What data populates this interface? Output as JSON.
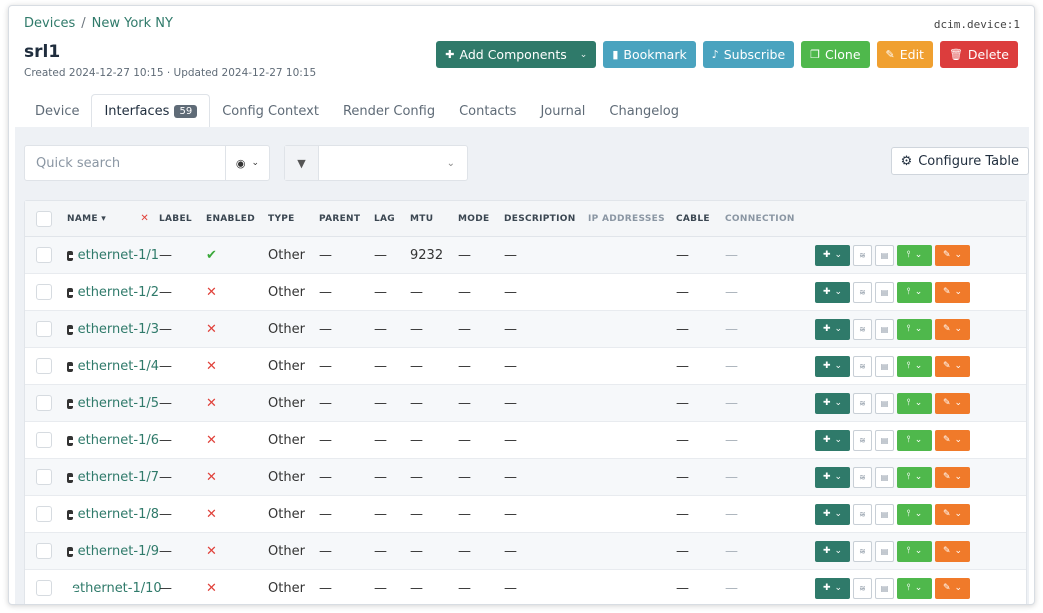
{
  "breadcrumb": [
    "Devices",
    "New York NY"
  ],
  "object_id": "dcim.device:1",
  "title": "srl1",
  "meta": "Created 2024-12-27 10:15 · Updated 2024-12-27 10:15",
  "actions": {
    "add_components": "Add Components",
    "bookmark": "Bookmark",
    "subscribe": "Subscribe",
    "clone": "Clone",
    "edit": "Edit",
    "delete": "Delete"
  },
  "tabs": [
    {
      "label": "Device"
    },
    {
      "label": "Interfaces",
      "badge": "59"
    },
    {
      "label": "Config Context"
    },
    {
      "label": "Render Config"
    },
    {
      "label": "Contacts"
    },
    {
      "label": "Journal"
    },
    {
      "label": "Changelog"
    }
  ],
  "search": {
    "placeholder": "Quick search"
  },
  "configure_table": "Configure Table",
  "columns": [
    "NAME",
    "LABEL",
    "ENABLED",
    "TYPE",
    "PARENT",
    "LAG",
    "MTU",
    "MODE",
    "DESCRIPTION",
    "IP ADDRESSES",
    "CABLE",
    "CONNECTION"
  ],
  "rows": [
    {
      "name": "ethernet-1/1",
      "enabled": true,
      "type": "Other",
      "mtu": "9232"
    },
    {
      "name": "ethernet-1/2",
      "enabled": false,
      "type": "Other",
      "mtu": "—"
    },
    {
      "name": "ethernet-1/3",
      "enabled": false,
      "type": "Other",
      "mtu": "—"
    },
    {
      "name": "ethernet-1/4",
      "enabled": false,
      "type": "Other",
      "mtu": "—"
    },
    {
      "name": "ethernet-1/5",
      "enabled": false,
      "type": "Other",
      "mtu": "—"
    },
    {
      "name": "ethernet-1/6",
      "enabled": false,
      "type": "Other",
      "mtu": "—"
    },
    {
      "name": "ethernet-1/7",
      "enabled": false,
      "type": "Other",
      "mtu": "—"
    },
    {
      "name": "ethernet-1/8",
      "enabled": false,
      "type": "Other",
      "mtu": "—"
    },
    {
      "name": "ethernet-1/9",
      "enabled": false,
      "type": "Other",
      "mtu": "—"
    },
    {
      "name": "ethernet-1/10",
      "enabled": false,
      "type": "Other",
      "mtu": "—"
    }
  ],
  "empty": "—",
  "colors": {
    "teal": "#2f7a6a",
    "cyan": "#4aa3bf",
    "green": "#4fb84c",
    "orange": "#f0a030",
    "red": "#dc3d3d"
  }
}
